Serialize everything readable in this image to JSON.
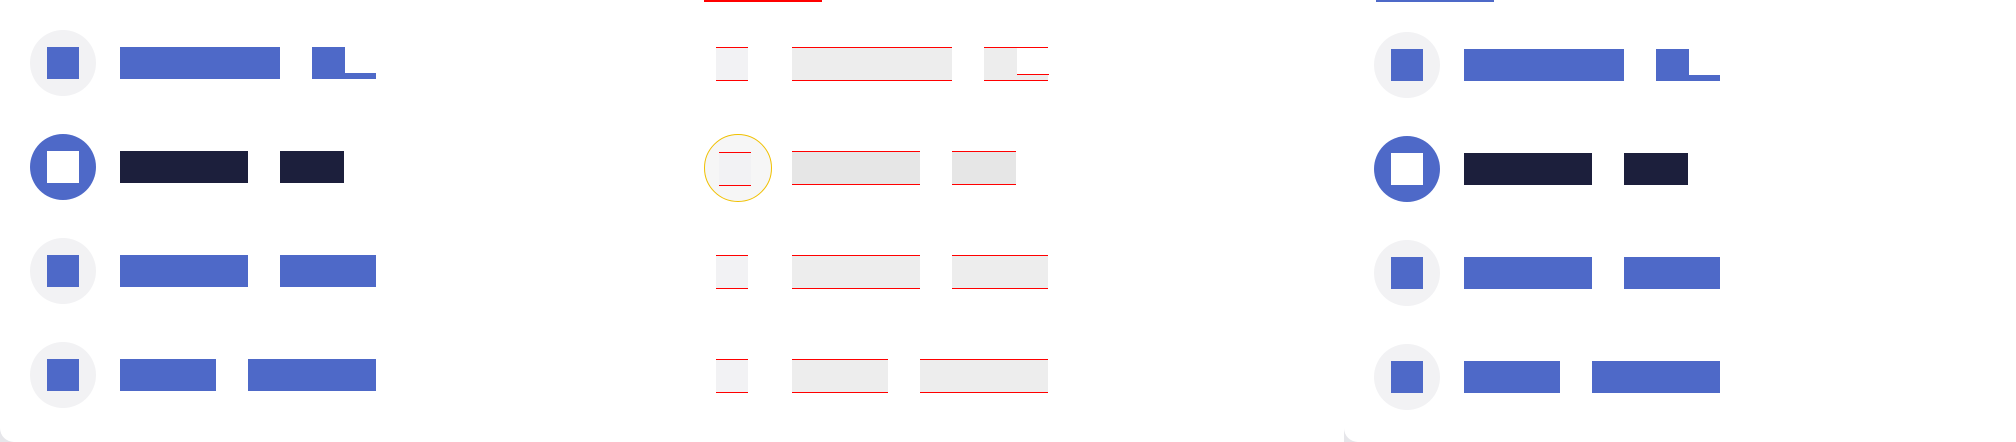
{
  "colors": {
    "accent": "#4e69c8",
    "dark": "#1c1f3c",
    "icon_bg": "#f2f2f4",
    "diff_red": "#ff0000",
    "focus_ring": "#f0c000"
  },
  "panels": [
    {
      "id": "panel-a",
      "style": "solid",
      "tab_indicator_color": "",
      "items": [
        {
          "icon": "square-icon",
          "state": "default",
          "badge": true
        },
        {
          "icon": "square-icon",
          "state": "active",
          "badge": false
        },
        {
          "icon": "square-icon",
          "state": "default",
          "badge": false
        },
        {
          "icon": "square-icon",
          "state": "default",
          "badge": false
        }
      ]
    },
    {
      "id": "panel-b",
      "style": "wireframe",
      "tab_indicator_color": "#ff0000",
      "items": [
        {
          "icon": "square-icon",
          "state": "default",
          "badge": true
        },
        {
          "icon": "square-icon",
          "state": "active",
          "badge": false
        },
        {
          "icon": "square-icon",
          "state": "default",
          "badge": false
        },
        {
          "icon": "square-icon",
          "state": "default",
          "badge": false
        }
      ]
    },
    {
      "id": "panel-c",
      "style": "solid",
      "tab_indicator_color": "#4e69c8",
      "items": [
        {
          "icon": "square-icon",
          "state": "default",
          "badge": true
        },
        {
          "icon": "square-icon",
          "state": "active",
          "badge": false
        },
        {
          "icon": "square-icon",
          "state": "default",
          "badge": false
        },
        {
          "icon": "square-icon",
          "state": "default",
          "badge": false
        }
      ]
    }
  ]
}
